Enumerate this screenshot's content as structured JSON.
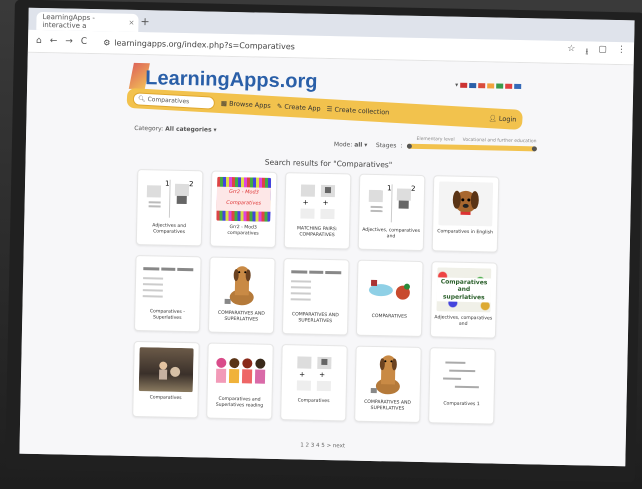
{
  "browser": {
    "tab_title": "LearningApps - interactive a",
    "tab_close": "×",
    "new_tab": "+",
    "url": "learningapps.org/index.php?s=Comparatives"
  },
  "site": {
    "logo": "LearningApps.org",
    "search_value": "Comparatives",
    "nav": [
      "Browse Apps",
      "Create App",
      "Create collection"
    ],
    "login": "Login",
    "category_label": "Category",
    "category_value": "All categories",
    "mode_label": "Mode",
    "mode_value": "all",
    "stages_label": "Stages",
    "stage_left": "Elementary level",
    "stage_right": "Vocational and further education",
    "results_title": "Search results for \"Comparatives\"",
    "pagination": "1 2 3 4 5 > next"
  },
  "cards": [
    {
      "caption": "Adjectives and Comparatives",
      "thumb": "numbers"
    },
    {
      "caption": "Grr2 - Mod3 comparatives",
      "thumb": "striped"
    },
    {
      "caption": "MATCHING PAIRS: COMPARATIVES",
      "thumb": "pairs"
    },
    {
      "caption": "Adjectives, comparatives and",
      "thumb": "numbers"
    },
    {
      "caption": "Comparatives in English",
      "thumb": "dog"
    },
    {
      "caption": "Comparatives - Superlatives",
      "thumb": "lines"
    },
    {
      "caption": "COMPARATIVES AND SUPERLATIVES",
      "thumb": "dogsit"
    },
    {
      "caption": "COMPARATIVES AND SUPERLATIVES",
      "thumb": "lines"
    },
    {
      "caption": "COMPARATIVES",
      "thumb": "animals"
    },
    {
      "caption": "Adjectives, comparatives and",
      "thumb": "flowers"
    },
    {
      "caption": "Comparatives",
      "thumb": "photo"
    },
    {
      "caption": "Comparatives and Superlatives reading",
      "thumb": "people"
    },
    {
      "caption": "Comparatives",
      "thumb": "pairs"
    },
    {
      "caption": "COMPARATIVES AND SUPERLATIVES",
      "thumb": "dogsit"
    },
    {
      "caption": "Comparatives 1",
      "thumb": "bars"
    }
  ],
  "thumb_text": {
    "striped": "Grr2 - Mod3 Comparatives",
    "flowers": "Comparatives and superlatives"
  },
  "colors": {
    "accent": "#f2c24d",
    "logo": "#2a5fa8"
  }
}
